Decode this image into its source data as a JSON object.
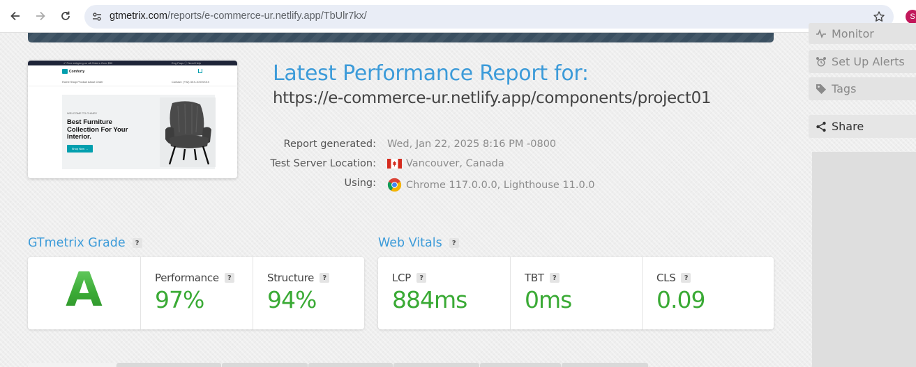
{
  "browser": {
    "url_host": "gtmetrix.com",
    "url_path": "/reports/e-commerce-ur.netlify.app/TbUlr7kx/",
    "profile_initial": "S"
  },
  "thumbnail": {
    "topbar_left": "✔ Free shipping on all Orders Over $50",
    "topbar_right": "Eng    Faqs    ⓘ Need Help",
    "logo": "Comforty",
    "nav": "Home    Shop    Product    About    Order",
    "contact": "Contact: (+92) 3XX-XXXXXXX",
    "welcome": "WELCOME TO CHAIRY",
    "headline": "Best Furniture Collection For Your Interior.",
    "cta": "Shop Now  →"
  },
  "report": {
    "title": "Latest Performance Report for:",
    "url": "https://e-commerce-ur.netlify.app/components/project01",
    "meta": [
      {
        "label": "Report generated:",
        "value": "Wed, Jan 22, 2025 8:16 PM -0800",
        "icon": ""
      },
      {
        "label": "Test Server Location:",
        "value": "Vancouver, Canada",
        "icon": "canada-flag-icon"
      },
      {
        "label": "Using:",
        "value": "Chrome 117.0.0.0, Lighthouse 11.0.0",
        "icon": "chrome-icon"
      }
    ]
  },
  "grade": {
    "heading": "GTmetrix Grade",
    "letter": "A",
    "performance_label": "Performance",
    "performance_value": "97%",
    "structure_label": "Structure",
    "structure_value": "94%"
  },
  "vitals": {
    "heading": "Web Vitals",
    "items": [
      {
        "label": "LCP",
        "value": "884ms"
      },
      {
        "label": "TBT",
        "value": "0ms"
      },
      {
        "label": "CLS",
        "value": "0.09"
      }
    ]
  },
  "help_glyph": "?",
  "sidebar": {
    "items": [
      {
        "label": "Monitor",
        "icon": "monitor-icon"
      },
      {
        "label": "Set Up Alerts",
        "icon": "alarm-clock-icon"
      },
      {
        "label": "Tags",
        "icon": "tag-icon"
      },
      {
        "label": "Share",
        "icon": "share-icon"
      }
    ]
  },
  "colors": {
    "accent_blue": "#3c9bd9",
    "grade_green": "#3aaa35",
    "banner": "#3a4f60"
  }
}
